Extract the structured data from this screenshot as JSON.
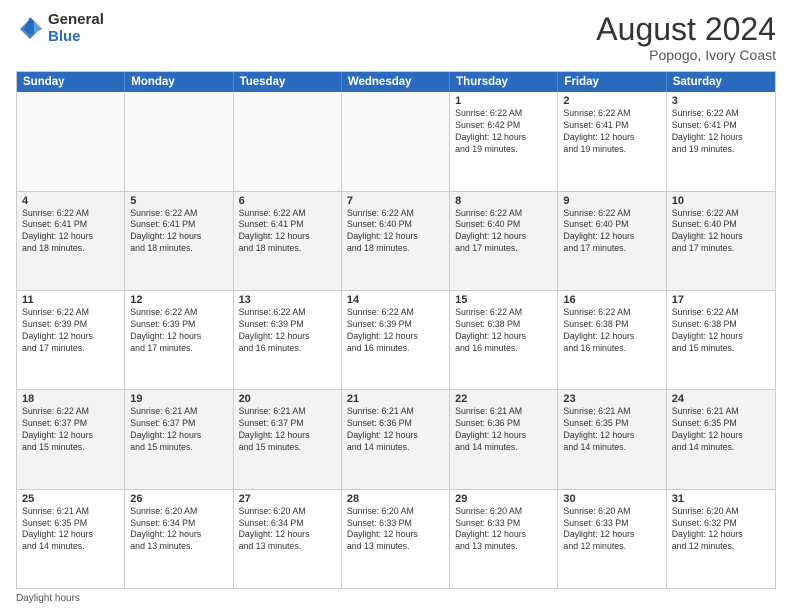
{
  "logo": {
    "general": "General",
    "blue": "Blue"
  },
  "title": "August 2024",
  "subtitle": "Popogo, Ivory Coast",
  "days": [
    "Sunday",
    "Monday",
    "Tuesday",
    "Wednesday",
    "Thursday",
    "Friday",
    "Saturday"
  ],
  "weeks": [
    [
      {
        "day": "",
        "info": ""
      },
      {
        "day": "",
        "info": ""
      },
      {
        "day": "",
        "info": ""
      },
      {
        "day": "",
        "info": ""
      },
      {
        "day": "1",
        "info": "Sunrise: 6:22 AM\nSunset: 6:42 PM\nDaylight: 12 hours\nand 19 minutes."
      },
      {
        "day": "2",
        "info": "Sunrise: 6:22 AM\nSunset: 6:41 PM\nDaylight: 12 hours\nand 19 minutes."
      },
      {
        "day": "3",
        "info": "Sunrise: 6:22 AM\nSunset: 6:41 PM\nDaylight: 12 hours\nand 19 minutes."
      }
    ],
    [
      {
        "day": "4",
        "info": "Sunrise: 6:22 AM\nSunset: 6:41 PM\nDaylight: 12 hours\nand 18 minutes."
      },
      {
        "day": "5",
        "info": "Sunrise: 6:22 AM\nSunset: 6:41 PM\nDaylight: 12 hours\nand 18 minutes."
      },
      {
        "day": "6",
        "info": "Sunrise: 6:22 AM\nSunset: 6:41 PM\nDaylight: 12 hours\nand 18 minutes."
      },
      {
        "day": "7",
        "info": "Sunrise: 6:22 AM\nSunset: 6:40 PM\nDaylight: 12 hours\nand 18 minutes."
      },
      {
        "day": "8",
        "info": "Sunrise: 6:22 AM\nSunset: 6:40 PM\nDaylight: 12 hours\nand 17 minutes."
      },
      {
        "day": "9",
        "info": "Sunrise: 6:22 AM\nSunset: 6:40 PM\nDaylight: 12 hours\nand 17 minutes."
      },
      {
        "day": "10",
        "info": "Sunrise: 6:22 AM\nSunset: 6:40 PM\nDaylight: 12 hours\nand 17 minutes."
      }
    ],
    [
      {
        "day": "11",
        "info": "Sunrise: 6:22 AM\nSunset: 6:39 PM\nDaylight: 12 hours\nand 17 minutes."
      },
      {
        "day": "12",
        "info": "Sunrise: 6:22 AM\nSunset: 6:39 PM\nDaylight: 12 hours\nand 17 minutes."
      },
      {
        "day": "13",
        "info": "Sunrise: 6:22 AM\nSunset: 6:39 PM\nDaylight: 12 hours\nand 16 minutes."
      },
      {
        "day": "14",
        "info": "Sunrise: 6:22 AM\nSunset: 6:39 PM\nDaylight: 12 hours\nand 16 minutes."
      },
      {
        "day": "15",
        "info": "Sunrise: 6:22 AM\nSunset: 6:38 PM\nDaylight: 12 hours\nand 16 minutes."
      },
      {
        "day": "16",
        "info": "Sunrise: 6:22 AM\nSunset: 6:38 PM\nDaylight: 12 hours\nand 16 minutes."
      },
      {
        "day": "17",
        "info": "Sunrise: 6:22 AM\nSunset: 6:38 PM\nDaylight: 12 hours\nand 15 minutes."
      }
    ],
    [
      {
        "day": "18",
        "info": "Sunrise: 6:22 AM\nSunset: 6:37 PM\nDaylight: 12 hours\nand 15 minutes."
      },
      {
        "day": "19",
        "info": "Sunrise: 6:21 AM\nSunset: 6:37 PM\nDaylight: 12 hours\nand 15 minutes."
      },
      {
        "day": "20",
        "info": "Sunrise: 6:21 AM\nSunset: 6:37 PM\nDaylight: 12 hours\nand 15 minutes."
      },
      {
        "day": "21",
        "info": "Sunrise: 6:21 AM\nSunset: 6:36 PM\nDaylight: 12 hours\nand 14 minutes."
      },
      {
        "day": "22",
        "info": "Sunrise: 6:21 AM\nSunset: 6:36 PM\nDaylight: 12 hours\nand 14 minutes."
      },
      {
        "day": "23",
        "info": "Sunrise: 6:21 AM\nSunset: 6:35 PM\nDaylight: 12 hours\nand 14 minutes."
      },
      {
        "day": "24",
        "info": "Sunrise: 6:21 AM\nSunset: 6:35 PM\nDaylight: 12 hours\nand 14 minutes."
      }
    ],
    [
      {
        "day": "25",
        "info": "Sunrise: 6:21 AM\nSunset: 6:35 PM\nDaylight: 12 hours\nand 14 minutes."
      },
      {
        "day": "26",
        "info": "Sunrise: 6:20 AM\nSunset: 6:34 PM\nDaylight: 12 hours\nand 13 minutes."
      },
      {
        "day": "27",
        "info": "Sunrise: 6:20 AM\nSunset: 6:34 PM\nDaylight: 12 hours\nand 13 minutes."
      },
      {
        "day": "28",
        "info": "Sunrise: 6:20 AM\nSunset: 6:33 PM\nDaylight: 12 hours\nand 13 minutes."
      },
      {
        "day": "29",
        "info": "Sunrise: 6:20 AM\nSunset: 6:33 PM\nDaylight: 12 hours\nand 13 minutes."
      },
      {
        "day": "30",
        "info": "Sunrise: 6:20 AM\nSunset: 6:33 PM\nDaylight: 12 hours\nand 12 minutes."
      },
      {
        "day": "31",
        "info": "Sunrise: 6:20 AM\nSunset: 6:32 PM\nDaylight: 12 hours\nand 12 minutes."
      }
    ]
  ],
  "footer": "Daylight hours"
}
